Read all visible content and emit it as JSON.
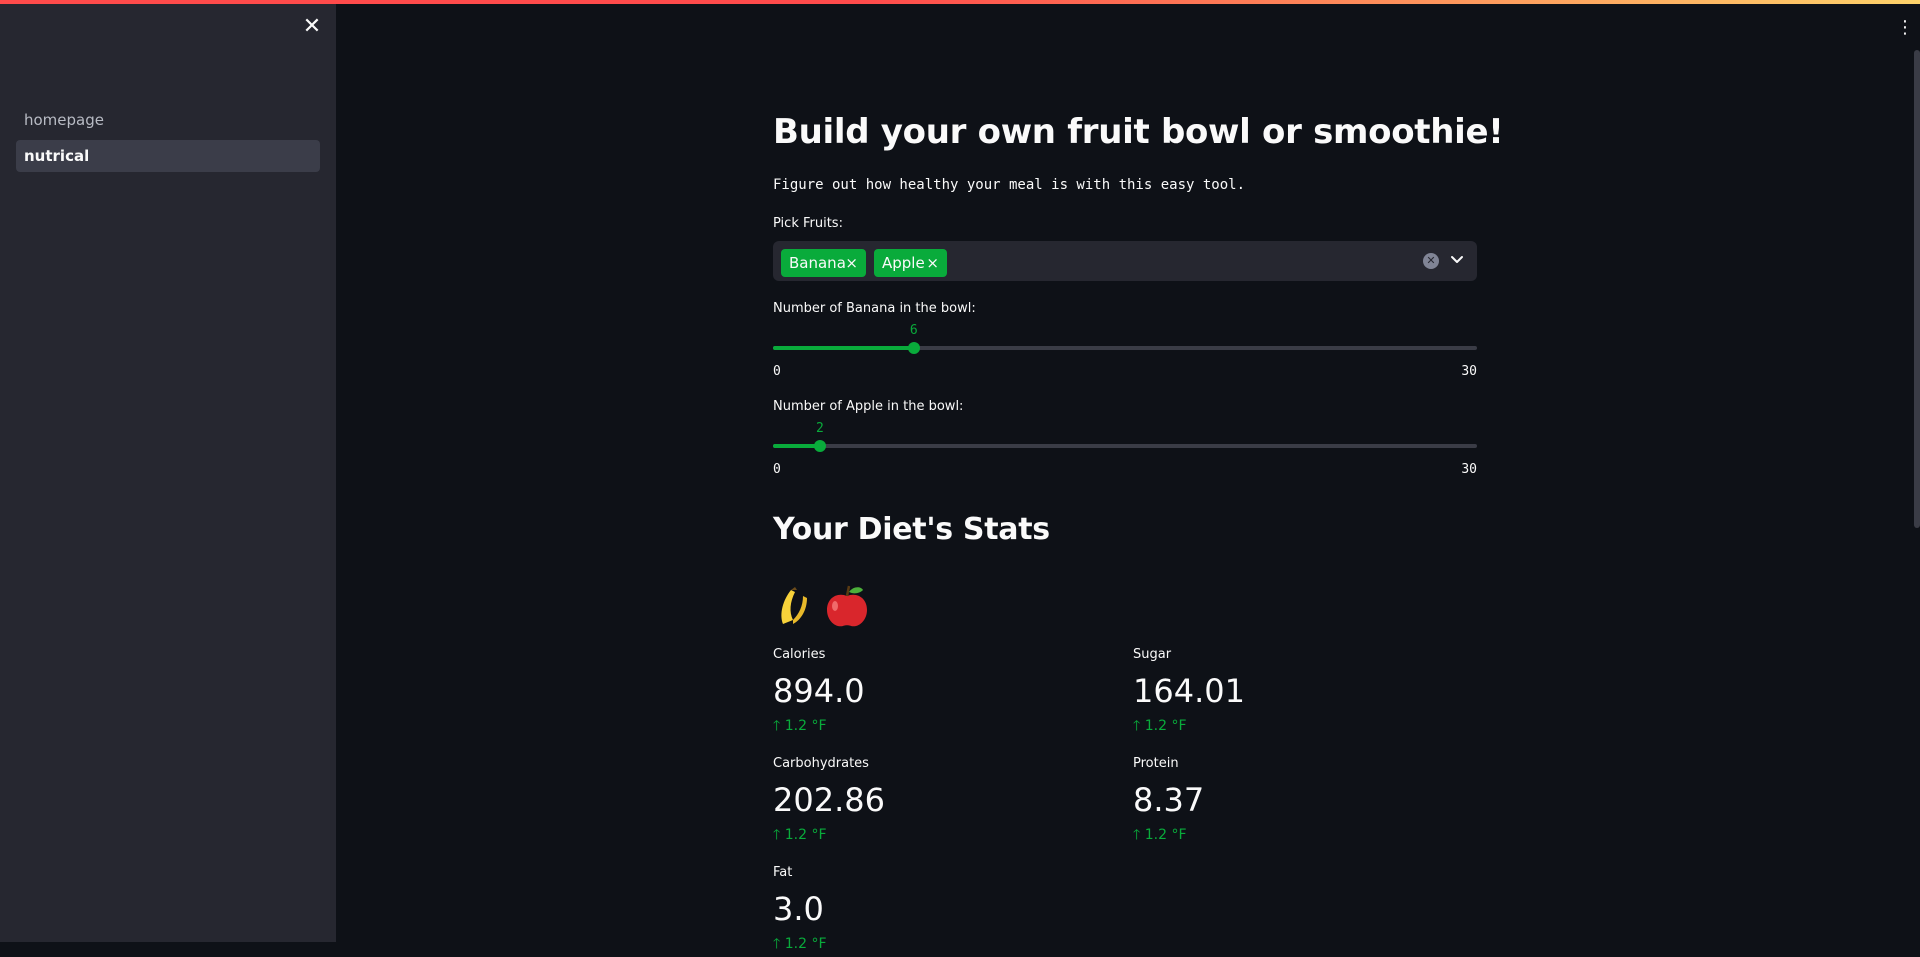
{
  "sidebar": {
    "close_icon": "close-icon",
    "nav": [
      {
        "label": "homepage",
        "active": false
      },
      {
        "label": "nutrical",
        "active": true
      }
    ]
  },
  "main": {
    "title": "Build your own fruit bowl or smoothie!",
    "subtitle": "Figure out how healthy your meal is with this easy tool.",
    "picker": {
      "label": "Pick Fruits:",
      "selected": [
        "Banana",
        "Apple"
      ]
    },
    "sliders": [
      {
        "label": "Number of Banana in the bowl:",
        "value": 6,
        "min": 0,
        "max": 30,
        "value_text": "6",
        "min_text": "0",
        "max_text": "30"
      },
      {
        "label": "Number of Apple in the bowl:",
        "value": 2,
        "min": 0,
        "max": 30,
        "value_text": "2",
        "min_text": "0",
        "max_text": "30"
      }
    ],
    "stats_title": "Your Diet's Stats",
    "fruit_icons": [
      "banana-icon",
      "apple-icon"
    ],
    "metrics": [
      {
        "label": "Calories",
        "value": "894.0",
        "delta": "1.2 °F"
      },
      {
        "label": "Sugar",
        "value": "164.01",
        "delta": "1.2 °F"
      },
      {
        "label": "Carbohydrates",
        "value": "202.86",
        "delta": "1.2 °F"
      },
      {
        "label": "Protein",
        "value": "8.37",
        "delta": "1.2 °F"
      },
      {
        "label": "Fat",
        "value": "3.0",
        "delta": "1.2 °F"
      }
    ]
  },
  "colors": {
    "accent": "#09ab3b",
    "background": "#0e1117",
    "sidebar": "#262730"
  }
}
